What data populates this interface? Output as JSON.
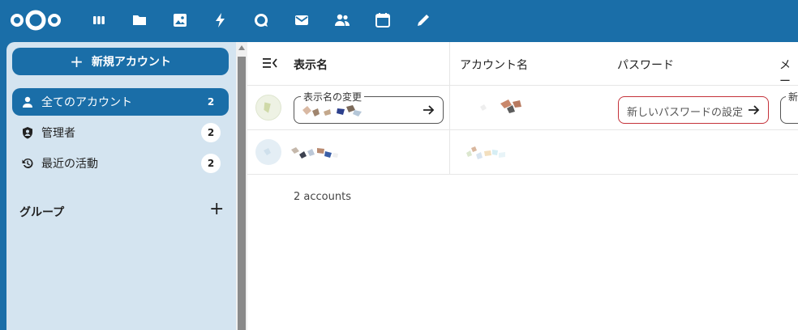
{
  "topbar": {
    "apps": [
      "dashboard-icon",
      "files-icon",
      "photos-icon",
      "activity-icon",
      "talk-icon",
      "mail-icon",
      "contacts-icon",
      "calendar-icon",
      "notes-icon"
    ]
  },
  "sidebar": {
    "new_account_label": "新規アカウント",
    "items": [
      {
        "label": "全てのアカウント",
        "count": "2",
        "icon": "user-icon",
        "active": true
      },
      {
        "label": "管理者",
        "count": "2",
        "icon": "shield-user-icon"
      },
      {
        "label": "最近の活動",
        "count": "2",
        "icon": "history-icon"
      }
    ],
    "groups_title": "グループ",
    "add_group_glyph": "+"
  },
  "table": {
    "headers": {
      "display_name": "表示名",
      "account_name": "アカウント名",
      "password": "パスワード",
      "email": "メー"
    },
    "edit_row": {
      "display_name_field_label": "表示名の変更",
      "password_placeholder": "新しいパスワードの設定",
      "email_field_label_partial": "新"
    },
    "footer": "2 accounts"
  },
  "colors": {
    "primary": "#1a6ea8",
    "sidebar_bg": "#d4e4f0",
    "password_border": "#c4323a"
  }
}
